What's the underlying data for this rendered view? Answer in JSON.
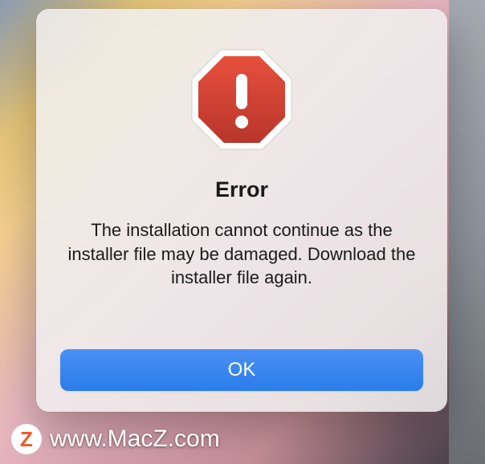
{
  "dialog": {
    "title": "Error",
    "message": "The installation cannot continue as the installer file may be damaged. Download the installer file again.",
    "ok_label": "OK"
  },
  "watermark": {
    "logo_letter": "Z",
    "text": "www.MacZ.com"
  },
  "colors": {
    "error_icon": "#C83B2E",
    "button_primary": "#2B7DE9"
  }
}
